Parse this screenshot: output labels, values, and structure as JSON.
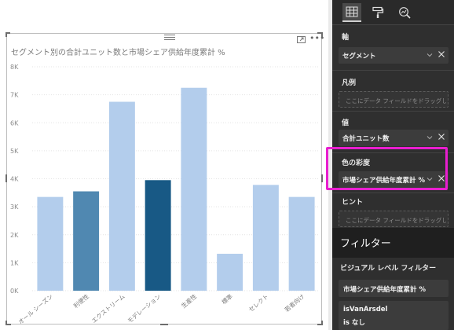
{
  "canvas": {
    "more_label": "•••"
  },
  "chart_data": {
    "type": "bar",
    "title": "セグメント別の合計ユニット数と市場シェア供給年度累計 %",
    "categories": [
      "オール シーズン",
      "利便性",
      "エクストリーム",
      "モデレーション",
      "生産性",
      "標準",
      "セレクト",
      "若者向け"
    ],
    "values": [
      3350,
      3550,
      6750,
      3950,
      7250,
      1320,
      3780,
      3350
    ],
    "saturation": [
      0.3,
      0.6,
      0.3,
      1.0,
      0.3,
      0.3,
      0.3,
      0.3
    ],
    "colors": {
      "light": "#b3cdec",
      "mid": "#5088b1",
      "dark": "#185985"
    },
    "y_ticks": [
      "0K",
      "1K",
      "2K",
      "3K",
      "4K",
      "5K",
      "6K",
      "7K",
      "8K"
    ],
    "ylim": [
      0,
      8000
    ],
    "xlabel": "",
    "ylabel": "",
    "grid": true
  },
  "pane": {
    "tabs": [
      {
        "name": "fields-icon"
      },
      {
        "name": "paint-roller-icon"
      },
      {
        "name": "analytics-icon"
      }
    ],
    "axis": {
      "label": "軸",
      "value": "セグメント"
    },
    "legend": {
      "label": "凡例",
      "placeholder": "ここにデータ フィールドをドラッグしてください"
    },
    "values": {
      "label": "値",
      "value": "合計ユニット数"
    },
    "saturation": {
      "label": "色の彩度",
      "value": "市場シェア供給年度累計 %"
    },
    "tooltips": {
      "label": "ヒント",
      "placeholder": "ここにデータ フィールドをドラッグしてください"
    }
  },
  "filters": {
    "title": "フィルター",
    "visual_level_label": "ビジュアル レベル フィルター",
    "items": [
      {
        "line1": "市場シェア供給年度累計 %"
      },
      {
        "line1": "isVanArsdel",
        "line2": "is なし"
      }
    ]
  },
  "highlight_color": "#e81ecf"
}
